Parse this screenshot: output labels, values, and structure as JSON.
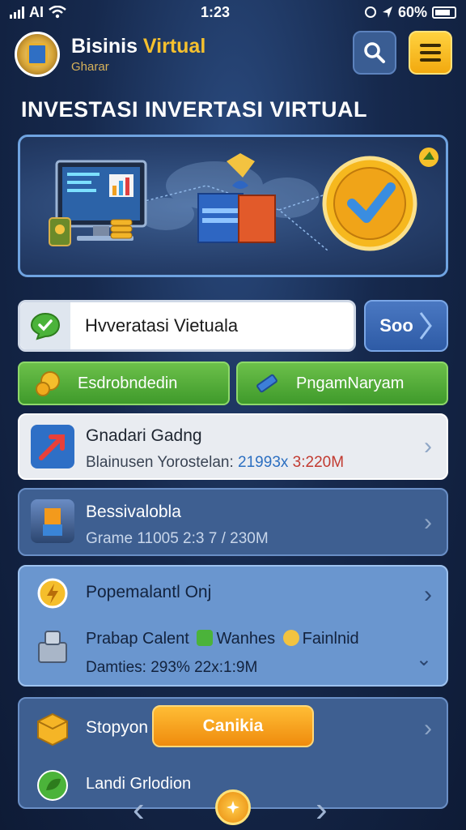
{
  "status_bar": {
    "carrier": "AI",
    "time": "1:23",
    "battery": "60%"
  },
  "header": {
    "title_part1": "Bisinis ",
    "title_part2": "Virtual",
    "subtitle": "Gharar",
    "search_icon": "search-icon",
    "menu_icon": "hamburger-menu-icon"
  },
  "page_title": "INVESTASI INVERTASI VIRTUAL",
  "search": {
    "value": "Hvveratasi Vietuala",
    "button_label": "Soo"
  },
  "actions": [
    {
      "label": "Esdrobndedin",
      "icon": "coins-icon"
    },
    {
      "label": "PngamNaryam",
      "icon": "pencil-icon"
    }
  ],
  "cards": [
    {
      "title": "Gnadari Gadng",
      "sub_prefix": "Blainusen Yorostelan: ",
      "sub_blue": "21993x",
      "sub_red": " 3:220M"
    },
    {
      "title": "Bessivalobla",
      "sub": "Grame  11005 2:3 7 / 230M"
    },
    {
      "title": "Popemalantl Onj",
      "row2": "Prabap Calent",
      "row2_b": "Wanhes",
      "row2_c": "Fainlnid",
      "sub": "Damties: 293%   22x:1:9M"
    },
    {
      "title": "Stopyon",
      "button_label": "Canikia",
      "row2": "Landi Grlodion"
    }
  ],
  "colors": {
    "accent_yellow": "#f5c02e",
    "green": "#4fa833",
    "orange": "#f29a17",
    "card_blue": "#3e5f91"
  }
}
